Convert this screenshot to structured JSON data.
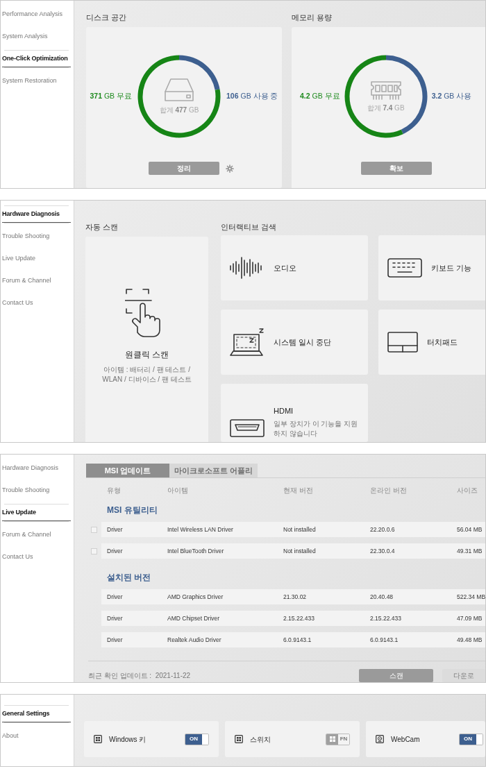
{
  "optimization": {
    "sidebar": [
      {
        "label": "Performance Analysis",
        "selected": false
      },
      {
        "label": "System Analysis",
        "selected": false
      },
      {
        "label": "One-Click Optimization",
        "selected": true
      },
      {
        "label": "System Restoration",
        "selected": false
      }
    ],
    "cards": [
      {
        "title": "디스크 공간",
        "kind": "disk",
        "free": "**371** GB 무료",
        "used": "**106** GB 사용 중",
        "total": "합계 **477** GB",
        "chart_data": {
          "type": "donut",
          "values": [
            22.2,
            77.8
          ]
        },
        "button": "정리",
        "settings": true
      },
      {
        "title": "메모리 용량",
        "kind": "memory",
        "free": "**4.2** GB 무료",
        "used": "**3.2** GB 사용",
        "total": "합계 **7.4** GB",
        "chart_data": {
          "type": "donut",
          "values": [
            43.2,
            56.8
          ]
        },
        "button": "확보",
        "settings": false
      }
    ]
  },
  "diagnosis": {
    "sidebar": [
      {
        "label": "Hardware Diagnosis",
        "selected": true
      },
      {
        "label": "Trouble Shooting",
        "selected": false
      },
      {
        "label": "Live Update",
        "selected": false
      },
      {
        "label": "Forum & Channel",
        "selected": false
      },
      {
        "label": "Contact Us",
        "selected": false
      }
    ],
    "auto_scan": {
      "title": "자동 스캔",
      "label": "원클릭 스캔",
      "description": "아이템 : 배터리 / 팬 테스트 / WLAN / 디바이스 / 팬 테스트"
    },
    "interactive": {
      "title": "인터랙티브 검색",
      "items": [
        {
          "kind": "audio",
          "label": "오디오"
        },
        {
          "kind": "keyboard",
          "label": "키보드 기능"
        },
        {
          "kind": "sleep",
          "label": "시스템 일시 중단"
        },
        {
          "kind": "touchpad",
          "label": "터치패드"
        },
        {
          "kind": "hdmi",
          "label": "HDMI",
          "note": "일부 장치가 이 기능을 지원하지 않습니다"
        }
      ]
    }
  },
  "live_update": {
    "sidebar": [
      {
        "label": "Hardware Diagnosis",
        "selected": false
      },
      {
        "label": "Trouble Shooting",
        "selected": false
      },
      {
        "label": "Live Update",
        "selected": true
      },
      {
        "label": "Forum & Channel",
        "selected": false
      },
      {
        "label": "Contact Us",
        "selected": false
      }
    ],
    "tabs": [
      {
        "label": "MSI 업데이트",
        "selected": true
      },
      {
        "label": "마이크로소프트 어플리",
        "selected": false
      }
    ],
    "columns": [
      "유형",
      "아이템",
      "현재 버전",
      "온라인 버전",
      "사이즈"
    ],
    "sections": [
      {
        "title": "MSI 유틸리티",
        "rows": [
          {
            "checked": false,
            "type": "Driver",
            "item": "Intel Wireless LAN Driver",
            "current": "Not installed",
            "online": "22.20.0.6",
            "size": "56.04 MB"
          },
          {
            "checked": false,
            "type": "Driver",
            "item": "Intel BlueTooth Driver",
            "current": "Not installed",
            "online": "22.30.0.4",
            "size": "49.31 MB"
          }
        ]
      },
      {
        "title": "설치된 버전",
        "rows": [
          {
            "type": "Driver",
            "item": "AMD Graphics Driver",
            "current": "21.30.02",
            "online": "20.40.48",
            "size": "522.34 MB"
          },
          {
            "type": "Driver",
            "item": "AMD Chipset Driver",
            "current": "2.15.22.433",
            "online": "2.15.22.433",
            "size": "47.09 MB"
          },
          {
            "type": "Driver",
            "item": "Realtek Audio Driver",
            "current": "6.0.9143.1",
            "online": "6.0.9143.1",
            "size": "49.48 MB"
          }
        ]
      }
    ],
    "last_check": "최근 확인 업데이트 :  2021-11-22",
    "buttons": [
      {
        "label": "스캔",
        "disabled": false
      },
      {
        "label": "다운로",
        "disabled": true
      }
    ]
  },
  "settings": {
    "sidebar": [
      {
        "label": "General Settings",
        "selected": true
      },
      {
        "label": "About",
        "selected": false
      }
    ],
    "items": [
      {
        "kind": "key",
        "label": "Windows 키",
        "toggle": {
          "on": true,
          "text": "ON"
        }
      },
      {
        "kind": "switch",
        "label": "스위치",
        "toggle": {
          "on": false,
          "text": "FN"
        }
      },
      {
        "kind": "webcam",
        "label": "WebCam",
        "toggle": {
          "on": true,
          "text": "ON"
        }
      }
    ]
  }
}
